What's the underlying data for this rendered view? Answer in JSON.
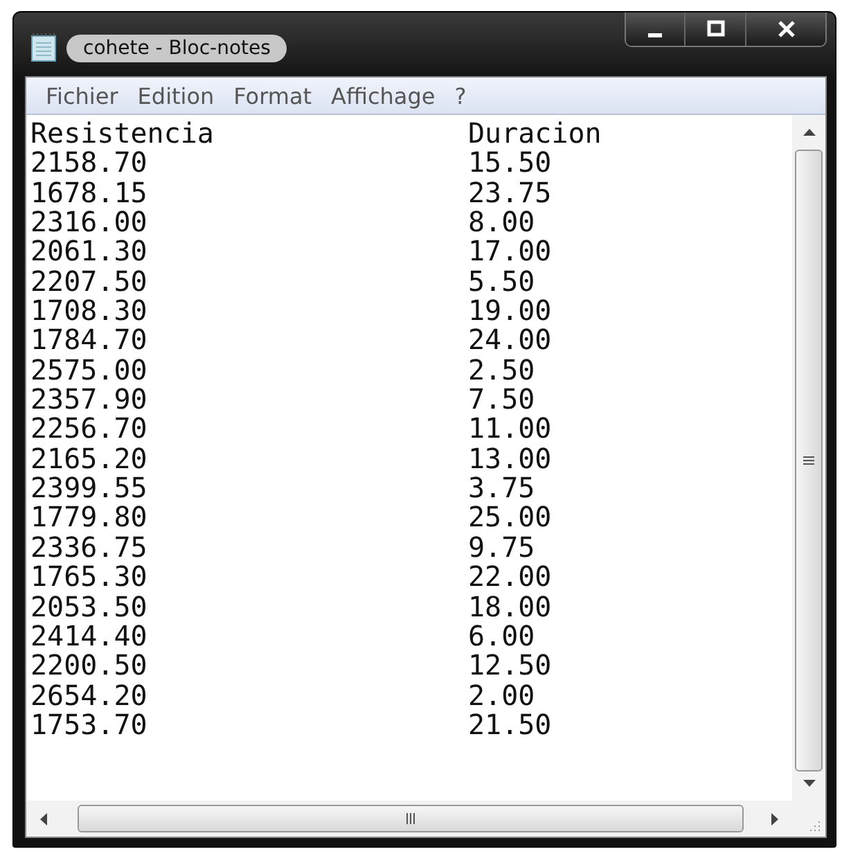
{
  "window": {
    "title": "cohete - Bloc-notes"
  },
  "menu": [
    "Fichier",
    "Edition",
    "Format",
    "Affichage",
    "?"
  ],
  "document": {
    "columns": [
      "Resistencia",
      "Duracion"
    ],
    "rows": [
      [
        "2158.70",
        "15.50"
      ],
      [
        "1678.15",
        "23.75"
      ],
      [
        "2316.00",
        "8.00"
      ],
      [
        "2061.30",
        "17.00"
      ],
      [
        "2207.50",
        "5.50"
      ],
      [
        "1708.30",
        "19.00"
      ],
      [
        "1784.70",
        "24.00"
      ],
      [
        "2575.00",
        "2.50"
      ],
      [
        "2357.90",
        "7.50"
      ],
      [
        "2256.70",
        "11.00"
      ],
      [
        "2165.20",
        "13.00"
      ],
      [
        "2399.55",
        "3.75"
      ],
      [
        "1779.80",
        "25.00"
      ],
      [
        "2336.75",
        "9.75"
      ],
      [
        "1765.30",
        "22.00"
      ],
      [
        "2053.50",
        "18.00"
      ],
      [
        "2414.40",
        "6.00"
      ],
      [
        "2200.50",
        "12.50"
      ],
      [
        "2654.20",
        "2.00"
      ],
      [
        "1753.70",
        "21.50"
      ]
    ]
  }
}
